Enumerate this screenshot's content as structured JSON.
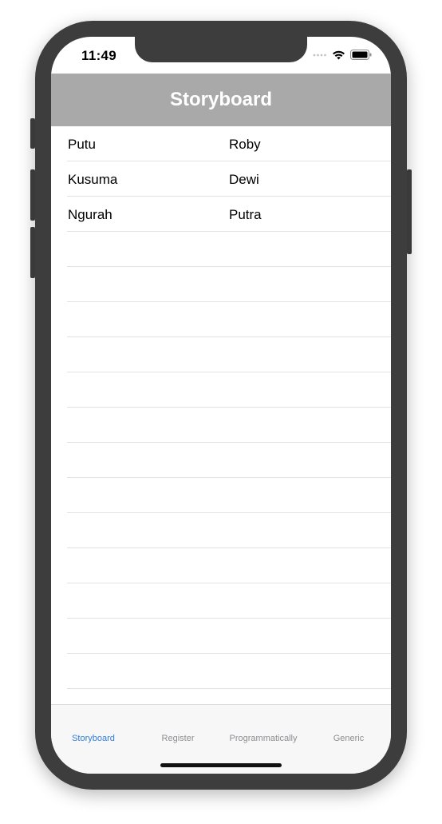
{
  "status_bar": {
    "time": "11:49",
    "icons": [
      "cellular-dots-icon",
      "wifi-icon",
      "battery-icon"
    ]
  },
  "nav": {
    "title": "Storyboard"
  },
  "table": {
    "rows": [
      {
        "first": "Putu",
        "second": "Roby"
      },
      {
        "first": "Kusuma",
        "second": "Dewi"
      },
      {
        "first": "Ngurah",
        "second": "Putra"
      },
      {
        "first": "",
        "second": ""
      },
      {
        "first": "",
        "second": ""
      },
      {
        "first": "",
        "second": ""
      },
      {
        "first": "",
        "second": ""
      },
      {
        "first": "",
        "second": ""
      },
      {
        "first": "",
        "second": ""
      },
      {
        "first": "",
        "second": ""
      },
      {
        "first": "",
        "second": ""
      },
      {
        "first": "",
        "second": ""
      },
      {
        "first": "",
        "second": ""
      },
      {
        "first": "",
        "second": ""
      },
      {
        "first": "",
        "second": ""
      },
      {
        "first": "",
        "second": ""
      }
    ]
  },
  "tab_bar": {
    "tabs": [
      {
        "label": "Storyboard",
        "active": true
      },
      {
        "label": "Register",
        "active": false
      },
      {
        "label": "Programmatically",
        "active": false
      },
      {
        "label": "Generic",
        "active": false
      }
    ]
  },
  "colors": {
    "nav_background": "#a9a9a9",
    "active_tab": "#2f7fd8",
    "inactive_tab": "#8e8e93",
    "device_frame": "#3d3d3d"
  }
}
